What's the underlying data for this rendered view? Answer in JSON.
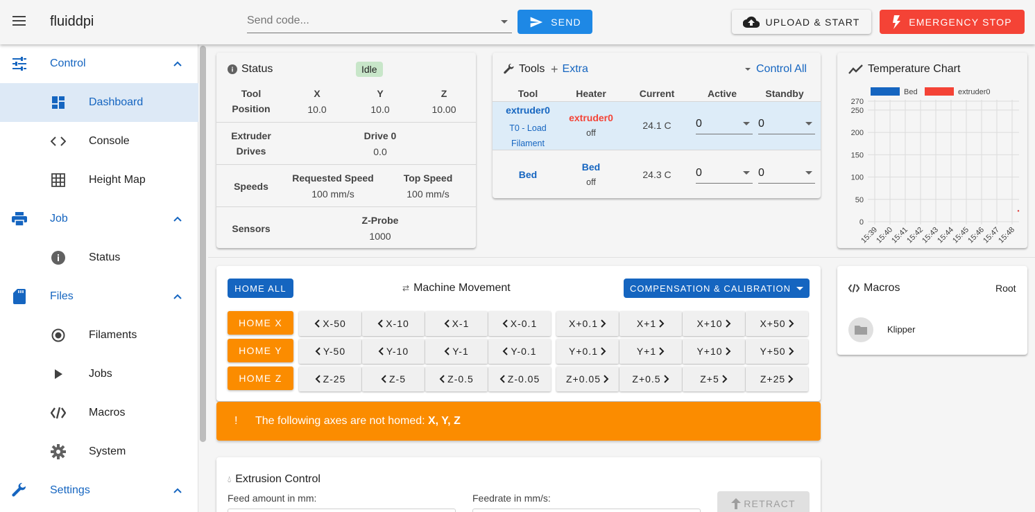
{
  "header": {
    "app_title": "fluiddpi",
    "send_placeholder": "Send code...",
    "send_label": "SEND",
    "upload_label": "UPLOAD & START",
    "emergency_label": "EMERGENCY STOP"
  },
  "sidebar": {
    "items": [
      {
        "label": "Control",
        "icon": "tune-icon"
      },
      {
        "label": "Dashboard",
        "icon": "dashboard-icon"
      },
      {
        "label": "Console",
        "icon": "code-icon"
      },
      {
        "label": "Height Map",
        "icon": "grid-icon"
      },
      {
        "label": "Job",
        "icon": "printer-icon"
      },
      {
        "label": "Status",
        "icon": "info-icon"
      },
      {
        "label": "Files",
        "icon": "sd-card-icon"
      },
      {
        "label": "Filaments",
        "icon": "radio-icon"
      },
      {
        "label": "Jobs",
        "icon": "play-icon"
      },
      {
        "label": "Macros",
        "icon": "macro-icon"
      },
      {
        "label": "System",
        "icon": "gear-icon"
      },
      {
        "label": "Settings",
        "icon": "wrench-icon"
      }
    ]
  },
  "status": {
    "title": "Status",
    "badge": "Idle",
    "tool_label_1": "Tool",
    "tool_label_2": "Position",
    "axes": [
      "X",
      "Y",
      "Z"
    ],
    "positions": [
      "10.0",
      "10.0",
      "10.00"
    ],
    "extruder_label_1": "Extruder",
    "extruder_label_2": "Drives",
    "drive_label": "Drive 0",
    "drive_value": "0.0",
    "speeds_label": "Speeds",
    "req_speed_label": "Requested Speed",
    "req_speed_value": "100 mm/s",
    "top_speed_label": "Top Speed",
    "top_speed_value": "100 mm/s",
    "sensors_label": "Sensors",
    "zprobe_label": "Z-Probe",
    "zprobe_value": "1000"
  },
  "tools": {
    "title": "Tools",
    "extra_label": "Extra",
    "control_all_label": "Control All",
    "columns": [
      "Tool",
      "Heater",
      "Current",
      "Active",
      "Standby"
    ],
    "rows": [
      {
        "tool": "extruder0",
        "tool_sub": "T0 - Load",
        "tool_sub2": "Filament",
        "heater": "extruder0",
        "heater_state": "off",
        "current": "24.1 C",
        "active": "0",
        "standby": "0"
      },
      {
        "tool": "Bed",
        "heater": "Bed",
        "heater_state": "off",
        "current": "24.3 C",
        "active": "0",
        "standby": "0"
      }
    ]
  },
  "temp_chart": {
    "title": "Temperature Chart"
  },
  "chart_data": {
    "type": "line",
    "series": [
      {
        "name": "Bed",
        "color": "#1565c0",
        "values": [
          24.3
        ]
      },
      {
        "name": "extruder0",
        "color": "#f44336",
        "values": [
          24.1
        ]
      }
    ],
    "x": [
      "15:39",
      "15:40",
      "15:41",
      "15:42",
      "15:43",
      "15:44",
      "15:45",
      "15:46",
      "15:47",
      "15:48"
    ],
    "yticks": [
      "270",
      "250",
      "200",
      "150",
      "100",
      "50",
      "0"
    ],
    "ylim": [
      0,
      270
    ],
    "grid": true,
    "legend": "top"
  },
  "movement": {
    "home_all": "HOME ALL",
    "title": "Machine Movement",
    "compensation": "COMPENSATION & CALIBRATION",
    "home_x": "HOME X",
    "home_y": "HOME Y",
    "home_z": "HOME Z",
    "x_neg": [
      "X-50",
      "X-10",
      "X-1",
      "X-0.1"
    ],
    "x_pos": [
      "X+0.1",
      "X+1",
      "X+10",
      "X+50"
    ],
    "y_neg": [
      "Y-50",
      "Y-10",
      "Y-1",
      "Y-0.1"
    ],
    "y_pos": [
      "Y+0.1",
      "Y+1",
      "Y+10",
      "Y+50"
    ],
    "z_neg": [
      "Z-25",
      "Z-5",
      "Z-0.5",
      "Z-0.05"
    ],
    "z_pos": [
      "Z+0.05",
      "Z+0.5",
      "Z+5",
      "Z+25"
    ],
    "warning_icon": "!",
    "warning_text": "The following axes are not homed:",
    "warning_axes": "X, Y, Z"
  },
  "macros": {
    "title": "Macros",
    "root_label": "Root",
    "folder_name": "Klipper"
  },
  "extrusion": {
    "title": "Extrusion Control",
    "feed_label": "Feed amount in mm:",
    "feedrate_label": "Feedrate in mm/s:",
    "retract_label": "RETRACT"
  }
}
